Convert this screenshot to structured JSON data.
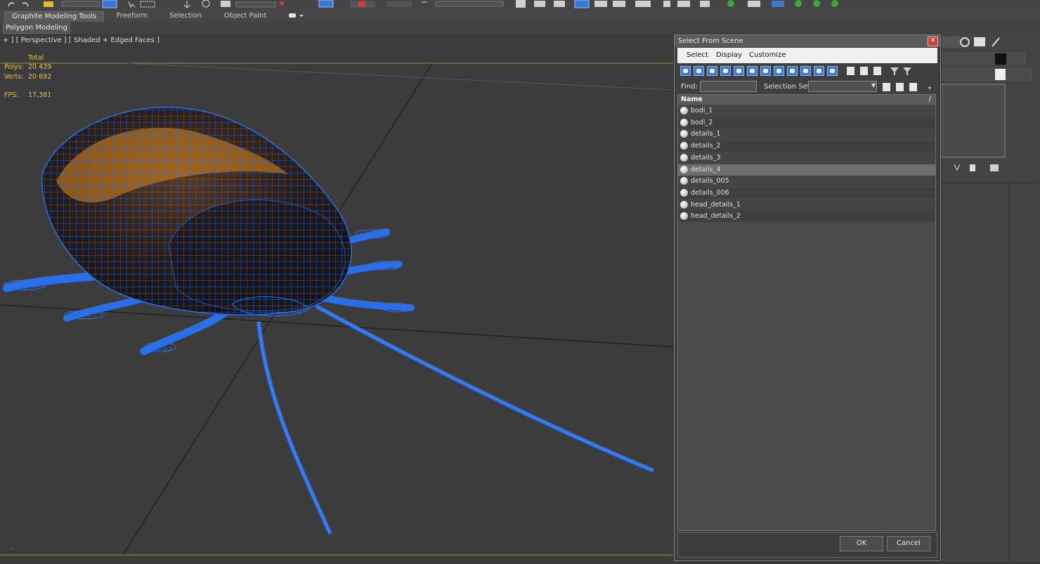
{
  "ribbon": {
    "tabs": [
      "Graphite Modeling Tools",
      "Freeform",
      "Selection",
      "Object Paint"
    ],
    "active_tab": "Graphite Modeling Tools",
    "sub_button": "Polygon Modeling"
  },
  "viewport": {
    "label": "+ ] [ Perspective ] [ Shaded + Edged Faces ]",
    "stats": {
      "total_label": "Total",
      "polys_label": "Polys:",
      "polys_value": "20 439",
      "verts_label": "Verts:",
      "verts_value": "20 692",
      "fps_label": "FPS:",
      "fps_value": "17,381"
    },
    "axis_label": "z"
  },
  "dialog": {
    "title": "Select From Scene",
    "close_glyph": "✕",
    "menu": [
      "Select",
      "Display",
      "Customize"
    ],
    "find_label": "Find:",
    "find_value": "",
    "selection_set_label": "Selection Set:",
    "selection_set_value": "",
    "list_header": "Name",
    "list_sort_glyph": "/",
    "items": [
      {
        "name": "bodi_1",
        "selected": false
      },
      {
        "name": "bodi_2",
        "selected": false
      },
      {
        "name": "details_1",
        "selected": false
      },
      {
        "name": "details_2",
        "selected": false
      },
      {
        "name": "details_3",
        "selected": false
      },
      {
        "name": "details_4",
        "selected": true
      },
      {
        "name": "details_005",
        "selected": false
      },
      {
        "name": "details_006",
        "selected": false
      },
      {
        "name": "head_details_1",
        "selected": false
      },
      {
        "name": "head_details_2",
        "selected": false
      }
    ],
    "ok_label": "OK",
    "cancel_label": "Cancel"
  },
  "colors": {
    "wire_blue": "#2a6fe8",
    "stats_yellow": "#e8c23a",
    "shell_orange": "#e08a1c",
    "dialog_bg": "#3d3d3d"
  }
}
